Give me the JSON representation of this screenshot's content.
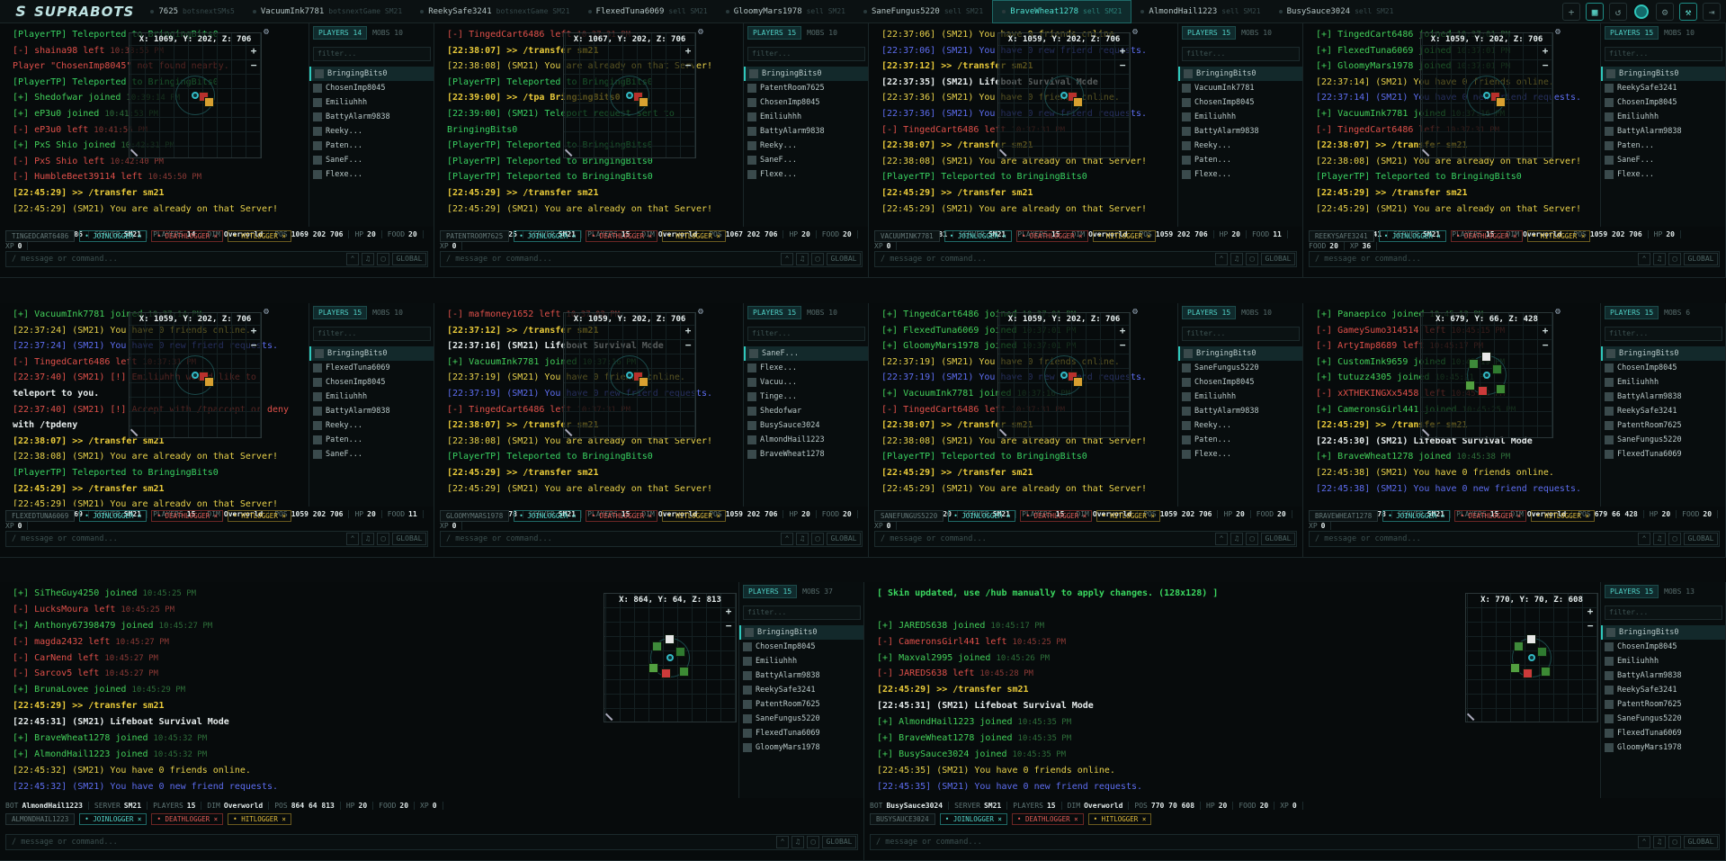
{
  "app": {
    "name": "SUPRABOTS",
    "count": "7625"
  },
  "tabs": [
    {
      "label": "7625",
      "sub": "botsnextSMs5"
    },
    {
      "label": "VacuumInk7781",
      "sub": "botsnextGame SM21"
    },
    {
      "label": "ReekySafe3241",
      "sub": "botsnextGame SM21"
    },
    {
      "label": "FlexedTuna6069",
      "sub": "sell SM21"
    },
    {
      "label": "GloomyMars1978",
      "sub": "sell SM21"
    },
    {
      "label": "SaneFungus5220",
      "sub": "sell SM21"
    },
    {
      "label": "BraveWheat1278",
      "sub": "sell SM21"
    },
    {
      "label": "AlmondHail1223",
      "sub": "sell SM21"
    },
    {
      "label": "BusySauce3024",
      "sub": "sell SM21"
    }
  ],
  "common": {
    "filter": "filter...",
    "message": "/ message or command...",
    "global": "GLOBAL",
    "tag_join": "• JOINLOGGER ×",
    "tag_death": "• DEATHLOGGER ×",
    "tag_hit": "• HITLOGGER ×",
    "k_bot": "BOT",
    "k_server": "SERVER",
    "k_players": "PLAYERS",
    "k_dim": "DIM",
    "k_pos": "POS",
    "k_hp": "HP",
    "k_food": "FOOD",
    "k_xp": "XP",
    "mobs": "MOBS"
  },
  "panes": [
    {
      "bot": "TingedCart6486",
      "badge": "TINGEDCART6486",
      "server": "SM21",
      "players": "14",
      "dim": "Overworld",
      "pos": "1069 202 706",
      "hp": "20",
      "food": "20",
      "xp": "0",
      "coord": "X: 1069, Y: 202, Z: 706",
      "plcount": "PLAYERS 14",
      "mobs": "MOBS 10",
      "chat": [
        [
          "tp",
          "[PlayerTP] Teleported to BringingBits0",
          ""
        ],
        [
          "left",
          "[-] shaina98 left",
          "10:38:55 PM"
        ],
        [
          "err",
          "Player \"ChosenImp8045\" not found nearby.",
          ""
        ],
        [
          "tp",
          "[PlayerTP] Teleported to BringingBits0",
          ""
        ],
        [
          "join",
          "[+] Shedofwar joined",
          "10:39:14 PM"
        ],
        [
          "join",
          "[+] eP3u0 joined",
          "10:41:53 PM"
        ],
        [
          "left",
          "[-] eP3u0 left",
          "10:41:56 PM"
        ],
        [
          "join",
          "[+] PxS Shio joined",
          "10:42:31 PM"
        ],
        [
          "left",
          "[-] PxS Shio left",
          "10:42:40 PM"
        ],
        [
          "left",
          "[-] HumbleBeet39114 left",
          "10:45:50 PM"
        ],
        [
          "cmd",
          "[22:45:29] >> /transfer sm21",
          ""
        ],
        [
          "warn",
          "[22:45:29] (SM21) You are already on that Server!",
          ""
        ]
      ],
      "list": [
        "BringingBits0",
        "ChosenImp8045",
        "Emiliuhhh",
        "BattyAlarm9838",
        "Reeky...",
        "Paten...",
        "SaneF...",
        "Flexe..."
      ]
    },
    {
      "bot": "PatentRoom7625",
      "badge": "PATENTROOM7625",
      "server": "SM21",
      "players": "15",
      "dim": "Overworld",
      "pos": "1067 202 706",
      "hp": "20",
      "food": "20",
      "xp": "0",
      "coord": "X: 1067, Y: 202, Z: 706",
      "plcount": "PLAYERS 15",
      "mobs": "MOBS 10",
      "chat": [
        [
          "left",
          "[-] TingedCart6486 left",
          "10:37:31 PM"
        ],
        [
          "cmd",
          "[22:38:07] >> /transfer sm21",
          ""
        ],
        [
          "warn",
          "[22:38:08] (SM21) You are already on that Server!",
          ""
        ],
        [
          "tp",
          "[PlayerTP] Teleported to BringingBits0",
          ""
        ],
        [
          "cmd",
          "[22:39:00] >> /tpa BringingBits0",
          ""
        ],
        [
          "tp",
          "[22:39:00] (SM21) Teleport request sent to",
          ""
        ],
        [
          "tp",
          "BringingBits0",
          ""
        ],
        [
          "tp",
          "[PlayerTP] Teleported to BringingBits0",
          ""
        ],
        [
          "tp",
          "[PlayerTP] Teleported to BringingBits0",
          ""
        ],
        [
          "tp",
          "[PlayerTP] Teleported to BringingBits0",
          ""
        ],
        [
          "cmd",
          "[22:45:29] >> /transfer sm21",
          ""
        ],
        [
          "warn",
          "[22:45:29] (SM21) You are already on that Server!",
          ""
        ]
      ],
      "list": [
        "BringingBits0",
        "PatentRoom7625",
        "ChosenImp8045",
        "Emiliuhhh",
        "BattyAlarm9838",
        "Reeky...",
        "SaneF...",
        "Flexe..."
      ]
    },
    {
      "bot": "VacuumInk7781",
      "badge": "VACUUMINK7781",
      "server": "SM21",
      "players": "15",
      "dim": "Overworld",
      "pos": "1059 202 706",
      "hp": "20",
      "food": "11",
      "xp": "0",
      "coord": "X: 1059, Y: 202, Z: 706",
      "plcount": "PLAYERS 15",
      "mobs": "MOBS 10",
      "chat": [
        [
          "warn",
          "[22:37:06] (SM21) You have 0 friends online.",
          ""
        ],
        [
          "blue",
          "[22:37:06] (SM21) You have 0 new friend requests.",
          ""
        ],
        [
          "cmd",
          "[22:37:12] >> /transfer sm21",
          ""
        ],
        [
          "white",
          "[22:37:35] (SM21) Lifeboat Survival Mode",
          ""
        ],
        [
          "warn",
          "[22:37:36] (SM21) You have 0 friends online.",
          ""
        ],
        [
          "blue",
          "[22:37:36] (SM21) You have 0 new friend requests.",
          ""
        ],
        [
          "left",
          "[-] TingedCart6486 left",
          "10:37:31 PM"
        ],
        [
          "cmd",
          "[22:38:07] >> /transfer sm21",
          ""
        ],
        [
          "warn",
          "[22:38:08] (SM21) You are already on that Server!",
          ""
        ],
        [
          "tp",
          "[PlayerTP] Teleported to BringingBits0",
          ""
        ],
        [
          "cmd",
          "[22:45:29] >> /transfer sm21",
          ""
        ],
        [
          "warn",
          "[22:45:29] (SM21) You are already on that Server!",
          ""
        ]
      ],
      "list": [
        "BringingBits0",
        "VacuumInk7781",
        "ChosenImp8045",
        "Emiliuhhh",
        "BattyAlarm9838",
        "Reeky...",
        "Paten...",
        "Flexe..."
      ]
    },
    {
      "bot": "ReekySafe3241",
      "badge": "REEKYSAFE3241",
      "server": "SM21",
      "players": "15",
      "dim": "Overworld",
      "pos": "1059 202 706",
      "hp": "20",
      "food": "20",
      "xp": "36",
      "coord": "X: 1059, Y: 202, Z: 706",
      "plcount": "PLAYERS 15",
      "mobs": "MOBS 10",
      "chat": [
        [
          "join",
          "[+] TingedCart6486 joined",
          "10:37:01 PM"
        ],
        [
          "join",
          "[+] FlexedTuna6069 joined",
          "10:37:01 PM"
        ],
        [
          "join",
          "[+] GloomyMars1978 joined",
          "10:37:01 PM"
        ],
        [
          "warn",
          "[22:37:14] (SM21) You have 0 friends online.",
          ""
        ],
        [
          "blue",
          "[22:37:14] (SM21) You have 0 new friend requests.",
          ""
        ],
        [
          "join",
          "[+] VacuumInk7781 joined",
          "10:37:16 PM"
        ],
        [
          "left",
          "[-] TingedCart6486 left",
          "10:37:31 PM"
        ],
        [
          "cmd",
          "[22:38:07] >> /transfer sm21",
          ""
        ],
        [
          "warn",
          "[22:38:08] (SM21) You are already on that Server!",
          ""
        ],
        [
          "tp",
          "[PlayerTP] Teleported to BringingBits0",
          ""
        ],
        [
          "cmd",
          "[22:45:29] >> /transfer sm21",
          ""
        ],
        [
          "warn",
          "[22:45:29] (SM21) You are already on that Server!",
          ""
        ]
      ],
      "list": [
        "BringingBits0",
        "ReekySafe3241",
        "ChosenImp8045",
        "Emiliuhhh",
        "BattyAlarm9838",
        "Paten...",
        "SaneF...",
        "Flexe..."
      ]
    },
    {
      "bot": "FlexedTuna6069",
      "badge": "FLEXEDTUNA6069",
      "server": "SM21",
      "players": "15",
      "dim": "Overworld",
      "pos": "1059 202 706",
      "hp": "20",
      "food": "11",
      "xp": "0",
      "coord": "X: 1059, Y: 202, Z: 706",
      "plcount": "PLAYERS 15",
      "mobs": "MOBS 10",
      "chat": [
        [
          "join",
          "[+] VacuumInk7781 joined",
          "10:37:14 PM"
        ],
        [
          "warn",
          "[22:37:24] (SM21) You have 0 friends online.",
          ""
        ],
        [
          "blue",
          "[22:37:24] (SM21) You have 0 new friend requests.",
          ""
        ],
        [
          "left",
          "[-] TingedCart6486 left",
          "10:37:31 PM"
        ],
        [
          "err",
          "[22:37:40] (SM21) [!] Emiliuhhh would like to",
          ""
        ],
        [
          "white",
          "teleport to you.",
          ""
        ],
        [
          "err",
          "[22:37:40] (SM21) [!] Accept with /tpaccept or deny",
          ""
        ],
        [
          "white",
          "with /tpdeny",
          ""
        ],
        [
          "cmd",
          "[22:38:07] >> /transfer sm21",
          ""
        ],
        [
          "warn",
          "[22:38:08] (SM21) You are already on that Server!",
          ""
        ],
        [
          "tp",
          "[PlayerTP] Teleported to BringingBits0",
          ""
        ],
        [
          "cmd",
          "[22:45:29] >> /transfer sm21",
          ""
        ],
        [
          "warn",
          "[22:45:29] (SM21) You are already on that Server!",
          ""
        ]
      ],
      "list": [
        "BringingBits0",
        "FlexedTuna6069",
        "ChosenImp8045",
        "Emiliuhhh",
        "BattyAlarm9838",
        "Reeky...",
        "Paten...",
        "SaneF..."
      ]
    },
    {
      "bot": "GloomyMars1978",
      "badge": "GLOOMYMARS1978",
      "server": "SM21",
      "players": "15",
      "dim": "Overworld",
      "pos": "1059 202 706",
      "hp": "20",
      "food": "20",
      "xp": "0",
      "coord": "X: 1059, Y: 202, Z: 706",
      "plcount": "PLAYERS 15",
      "mobs": "MOBS 10",
      "chat": [
        [
          "left",
          "[-] mafmoney1652 left",
          "10:37:03 PM"
        ],
        [
          "cmd",
          "[22:37:12] >> /transfer sm21",
          ""
        ],
        [
          "white",
          "[22:37:16] (SM21) Lifeboat Survival Mode",
          ""
        ],
        [
          "join",
          "[+] VacuumInk7781 joined",
          "10:37:16 PM"
        ],
        [
          "warn",
          "[22:37:19] (SM21) You have 0 friends online.",
          ""
        ],
        [
          "blue",
          "[22:37:19] (SM21) You have 0 new friend requests.",
          ""
        ],
        [
          "left",
          "[-] TingedCart6486 left",
          "10:37:31 PM"
        ],
        [
          "cmd",
          "[22:38:07] >> /transfer sm21",
          ""
        ],
        [
          "warn",
          "[22:38:08] (SM21) You are already on that Server!",
          ""
        ],
        [
          "tp",
          "[PlayerTP] Teleported to BringingBits0",
          ""
        ],
        [
          "cmd",
          "[22:45:29] >> /transfer sm21",
          ""
        ],
        [
          "warn",
          "[22:45:29] (SM21) You are already on that Server!",
          ""
        ]
      ],
      "list": [
        "SaneF...",
        "Flexe...",
        "Vacuu...",
        "Tinge...",
        "Shedofwar",
        "BusySauce3024",
        "AlmondHail1223",
        "BraveWheat1278"
      ]
    },
    {
      "bot": "SaneFungus5220",
      "badge": "SANEFUNGUS5220",
      "server": "SM21",
      "players": "15",
      "dim": "Overworld",
      "pos": "1059 202 706",
      "hp": "20",
      "food": "20",
      "xp": "0",
      "coord": "X: 1059, Y: 202, Z: 706",
      "plcount": "PLAYERS 15",
      "mobs": "MOBS 10",
      "chat": [
        [
          "join",
          "[+] TingedCart6486 joined",
          "10:37:01 PM"
        ],
        [
          "join",
          "[+] FlexedTuna6069 joined",
          "10:37:01 PM"
        ],
        [
          "join",
          "[+] GloomyMars1978 joined",
          "10:37:01 PM"
        ],
        [
          "warn",
          "[22:37:19] (SM21) You have 0 friends online.",
          ""
        ],
        [
          "blue",
          "[22:37:19] (SM21) You have 0 new friend requests.",
          ""
        ],
        [
          "join",
          "[+] VacuumInk7781 joined",
          "10:37:16 PM"
        ],
        [
          "left",
          "[-] TingedCart6486 left",
          "10:37:31 PM"
        ],
        [
          "cmd",
          "[22:38:07] >> /transfer sm21",
          ""
        ],
        [
          "warn",
          "[22:38:08] (SM21) You are already on that Server!",
          ""
        ],
        [
          "tp",
          "[PlayerTP] Teleported to BringingBits0",
          ""
        ],
        [
          "cmd",
          "[22:45:29] >> /transfer sm21",
          ""
        ],
        [
          "warn",
          "[22:45:29] (SM21) You are already on that Server!",
          ""
        ]
      ],
      "list": [
        "BringingBits0",
        "SaneFungus5220",
        "ChosenImp8045",
        "Emiliuhhh",
        "BattyAlarm9838",
        "Reeky...",
        "Paten...",
        "Flexe..."
      ]
    },
    {
      "bot": "BraveWheat1278",
      "badge": "BRAVEWHEAT1278",
      "server": "SM21",
      "players": "15",
      "dim": "Overworld",
      "pos": "679 66 428",
      "hp": "20",
      "food": "20",
      "xp": "0",
      "coord": "X: 679, Y: 66, Z: 428",
      "plcount": "PLAYERS 15",
      "mobs": "MOBS 6",
      "chat": [
        [
          "join",
          "[+] Panaepico joined",
          "10:45:13 PM"
        ],
        [
          "left",
          "[-] GameySumo314514 left",
          "10:45:15 PM"
        ],
        [
          "left",
          "[-] ArtyImp8689 left",
          "10:45:17 PM"
        ],
        [
          "join",
          "[+] CustomInk9659 joined",
          "10:45:19 PM"
        ],
        [
          "join",
          "[+] tutuzz4305 joined",
          "10:45:21 PM"
        ],
        [
          "left",
          "[-] xXTHEKINGXx5458 left",
          "10:45:22 PM"
        ],
        [
          "join",
          "[+] CameronsGirl441 joined",
          "10:45:25 PM"
        ],
        [
          "cmd",
          "[22:45:29] >> /transfer sm21",
          ""
        ],
        [
          "white",
          "[22:45:30] (SM21) Lifeboat Survival Mode",
          ""
        ],
        [
          "join",
          "[+] BraveWheat1278 joined",
          "10:45:38 PM"
        ],
        [
          "warn",
          "[22:45:38] (SM21) You have 0 friends online.",
          ""
        ],
        [
          "blue",
          "[22:45:38] (SM21) You have 0 new friend requests.",
          ""
        ]
      ],
      "list": [
        "BringingBits0",
        "ChosenImp8045",
        "Emiliuhhh",
        "BattyAlarm9838",
        "ReekySafe3241",
        "PatentRoom7625",
        "SaneFungus5220",
        "FlexedTuna6069"
      ]
    },
    {
      "bot": "AlmondHail1223",
      "badge": "ALMONDHAIL1223",
      "server": "SM21",
      "players": "15",
      "dim": "Overworld",
      "pos": "864 64 813",
      "hp": "20",
      "food": "20",
      "xp": "0",
      "coord": "X: 864, Y: 64, Z: 813",
      "plcount": "PLAYERS 15",
      "mobs": "MOBS 37",
      "chat": [
        [
          "join",
          "[+] SiTheGuy4250 joined",
          "10:45:25 PM"
        ],
        [
          "left",
          "[-] LucksMoura left",
          "10:45:25 PM"
        ],
        [
          "join",
          "[+] Anthony67398479 joined",
          "10:45:27 PM"
        ],
        [
          "left",
          "[-] magda2432 left",
          "10:45:27 PM"
        ],
        [
          "left",
          "[-] CarNend left",
          "10:45:27 PM"
        ],
        [
          "left",
          "[-] Sarcov5 left",
          "10:45:27 PM"
        ],
        [
          "join",
          "[+] BrunaLovee joined",
          "10:45:29 PM"
        ],
        [
          "cmd",
          "[22:45:29] >> /transfer sm21",
          ""
        ],
        [
          "white",
          "[22:45:31] (SM21) Lifeboat Survival Mode",
          ""
        ],
        [
          "join",
          "[+] BraveWheat1278 joined",
          "10:45:32 PM"
        ],
        [
          "join",
          "[+] AlmondHail1223 joined",
          "10:45:32 PM"
        ],
        [
          "warn",
          "[22:45:32] (SM21) You have 0 friends online.",
          ""
        ],
        [
          "blue",
          "[22:45:32] (SM21) You have 0 new friend requests.",
          ""
        ]
      ],
      "list": [
        "BringingBits0",
        "ChosenImp8045",
        "Emiliuhhh",
        "BattyAlarm9838",
        "ReekySafe3241",
        "PatentRoom7625",
        "SaneFungus5220",
        "FlexedTuna6069",
        "GloomyMars1978"
      ]
    },
    {
      "bot": "BusySauce3024",
      "badge": "BUSYSAUCE3024",
      "server": "SM21",
      "players": "15",
      "dim": "Overworld",
      "pos": "770 70 608",
      "hp": "20",
      "food": "20",
      "xp": "0",
      "coord": "X: 770, Y: 70, Z: 608",
      "plcount": "PLAYERS 15",
      "mobs": "MOBS 13",
      "chat": [
        [
          "gr",
          "[ Skin updated, use /hub manually to apply changes. (128x128) ]",
          ""
        ],
        [
          "gr",
          "",
          ""
        ],
        [
          "join",
          "[+] JAREDS638 joined",
          "10:45:17 PM"
        ],
        [
          "left",
          "[-] CameronsGirl441 left",
          "10:45:25 PM"
        ],
        [
          "join",
          "[+] Maxval2995 joined",
          "10:45:26 PM"
        ],
        [
          "left",
          "[-] JAREDS638 left",
          "10:45:28 PM"
        ],
        [
          "cmd",
          "[22:45:29] >> /transfer sm21",
          ""
        ],
        [
          "white",
          "[22:45:31] (SM21) Lifeboat Survival Mode",
          ""
        ],
        [
          "join",
          "[+] AlmondHail1223 joined",
          "10:45:35 PM"
        ],
        [
          "join",
          "[+] BraveWheat1278 joined",
          "10:45:35 PM"
        ],
        [
          "join",
          "[+] BusySauce3024 joined",
          "10:45:35 PM"
        ],
        [
          "warn",
          "[22:45:35] (SM21) You have 0 friends online.",
          ""
        ],
        [
          "blue",
          "[22:45:35] (SM21) You have 0 new friend requests.",
          ""
        ]
      ],
      "list": [
        "BringingBits0",
        "ChosenImp8045",
        "Emiliuhhh",
        "BattyAlarm9838",
        "ReekySafe3241",
        "PatentRoom7625",
        "SaneFungus5220",
        "FlexedTuna6069",
        "GloomyMars1978"
      ]
    }
  ]
}
